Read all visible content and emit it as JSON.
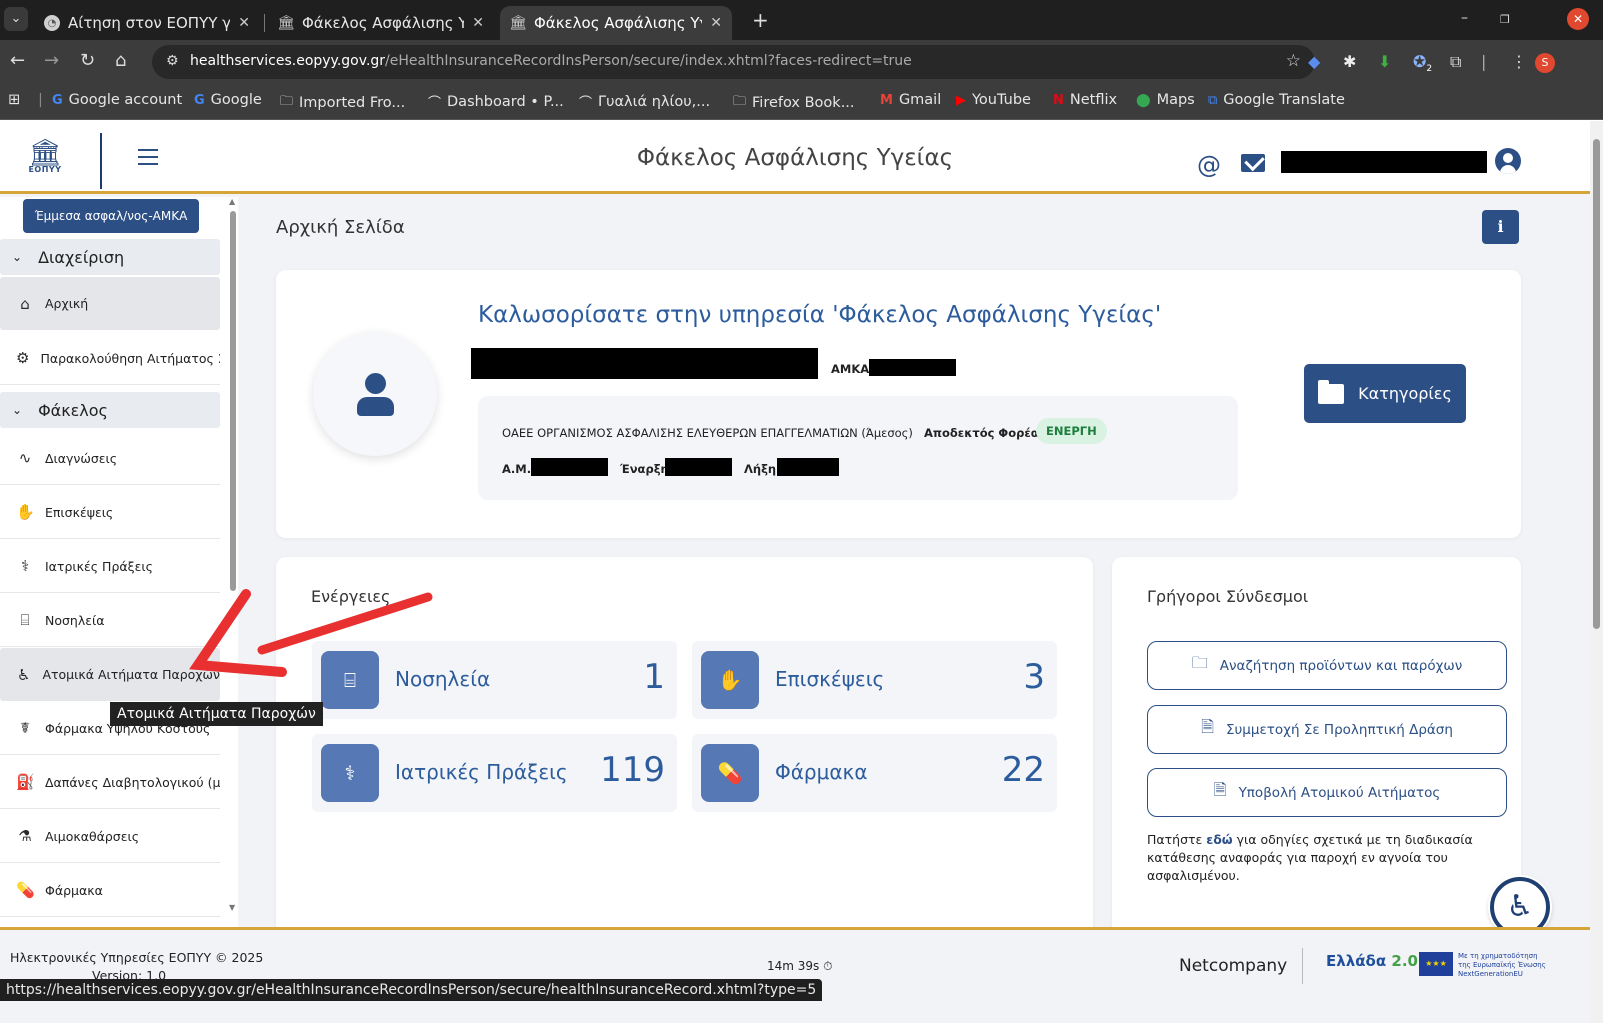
{
  "browser": {
    "tabs": [
      {
        "title": "Αίτηση στον ΕΟΠΥΥ για ν",
        "active": false
      },
      {
        "title": "Φάκελος Ασφάλισης Υγε",
        "active": false
      },
      {
        "title": "Φάκελος Ασφάλισης Υγε",
        "active": true
      }
    ],
    "url_host": "healthservices.eopyy.gov.gr",
    "url_path": "/eHealthInsuranceRecordInsPerson/secure/index.xhtml?faces-redirect=true",
    "profile_initial": "S",
    "extension_badge": "2",
    "bookmarks": [
      {
        "label": "Google account",
        "icon": "google-icon"
      },
      {
        "label": "Google",
        "icon": "google-icon"
      },
      {
        "label": "Imported Fro...",
        "icon": "folder-icon"
      },
      {
        "label": "Dashboard • P...",
        "icon": "sunglasses-icon"
      },
      {
        "label": "Γυαλιά ηλίου,...",
        "icon": "sunglasses-icon"
      },
      {
        "label": "Firefox Book...",
        "icon": "folder-icon"
      },
      {
        "label": "Gmail",
        "icon": "gmail-icon"
      },
      {
        "label": "YouTube",
        "icon": "youtube-icon"
      },
      {
        "label": "Netflix",
        "icon": "netflix-icon"
      },
      {
        "label": "Maps",
        "icon": "maps-icon"
      },
      {
        "label": "Google Translate",
        "icon": "translate-icon"
      }
    ],
    "status_url": "https://healthservices.eopyy.gov.gr/eHealthInsuranceRecordInsPerson/secure/healthInsuranceRecord.xhtml?type=5"
  },
  "header": {
    "logo_text": "ΕΟΠΥΥ",
    "title": "Φάκελος Ασφάλισης Υγείας",
    "at_symbol": "@"
  },
  "sidebar": {
    "indirect_button": "Έμμεσα ασφαλ/νος-ΑΜΚΑ",
    "sections": [
      {
        "label": "Διαχείριση",
        "items": [
          {
            "label": "Αρχική",
            "icon": "home-icon"
          },
          {
            "label": "Παρακολούθηση Αιτήματος Σ.Η.Π",
            "icon": "gear-icon"
          }
        ]
      },
      {
        "label": "Φάκελος",
        "items": [
          {
            "label": "Διαγνώσεις",
            "icon": "heartbeat-icon"
          },
          {
            "label": "Επισκέψεις",
            "icon": "hand-care-icon"
          },
          {
            "label": "Ιατρικές Πράξεις",
            "icon": "doctor-icon"
          },
          {
            "label": "Νοσηλεία",
            "icon": "bed-icon"
          },
          {
            "label": "Ατομικά Αιτήματα Παροχών",
            "icon": "wheelchair-icon"
          },
          {
            "label": "Φάρμακα Υψηλού Κόστους",
            "icon": "pill-hand-icon"
          },
          {
            "label": "Δαπάνες Διαβητολογικού (μέχρι ι",
            "icon": "glucose-icon"
          },
          {
            "label": "Αιμοκαθάρσεις",
            "icon": "dialysis-icon"
          },
          {
            "label": "Φάρμακα",
            "icon": "pills-icon"
          }
        ]
      }
    ],
    "tooltip": "Ατομικά Αιτήματα Παροχών"
  },
  "main": {
    "page_title": "Αρχική Σελίδα",
    "info_label": "i",
    "welcome": {
      "title": "Καλωσορίσατε στην υπηρεσία 'Φάκελος Ασφάλισης Υγείας'",
      "amka_label": "ΑΜΚΑ:",
      "insurer": "ΟΑΕΕ ΟΡΓΑΝΙΣΜΟΣ ΑΣΦΑΛΙΣΗΣ ΕΛΕΥΘΕΡΩΝ ΕΠΑΓΓΕΛΜΑΤΙΩΝ (Άμεσος)",
      "receiver_label": "Αποδεκτός Φορέας:",
      "status": "ΕΝΕΡΓΗ",
      "am_label": "Α.Μ.:",
      "start_label": "Έναρξη:",
      "end_label": "Λήξη:",
      "categories_button": "Κατηγορίες"
    },
    "actions": {
      "title": "Ενέργειες",
      "tiles": [
        {
          "label": "Νοσηλεία",
          "count": "1",
          "icon": "bed-icon"
        },
        {
          "label": "Επισκέψεις",
          "count": "3",
          "icon": "hand-care-icon"
        },
        {
          "label": "Ιατρικές Πράξεις",
          "count": "119",
          "icon": "doctor-icon"
        },
        {
          "label": "Φάρμακα",
          "count": "22",
          "icon": "pills-icon"
        }
      ]
    },
    "quick_links": {
      "title": "Γρήγοροι Σύνδεσμοι",
      "links": [
        {
          "label": "Αναζήτηση προϊόντων και παρόχων",
          "icon": "folder-search-icon"
        },
        {
          "label": "Συμμετοχή Σε Προληπτική Δράση",
          "icon": "document-icon"
        },
        {
          "label": "Υποβολή Ατομικού Αιτήματος",
          "icon": "document-icon"
        }
      ],
      "note_before": "Πατήστε ",
      "note_link": "εδώ",
      "note_after": " για οδηγίες σχετικά με τη διαδικασία κατάθεσης αναφοράς για παροχή εν αγνοία του ασφαλισμένου."
    }
  },
  "footer": {
    "copyright": "Ηλεκτρονικές Υπηρεσίες ΕΟΠΥΥ © 2025",
    "version": "Version: 1.0",
    "timer": "14m 39s",
    "vendor": "Netcompany",
    "greece_logo": "Ελλάδα",
    "greece_version": "2.0",
    "eu_text": "Με τη χρηματοδότηση της Ευρωπαϊκής Ένωσης NextGenerationEU"
  },
  "colors": {
    "primary": "#2c4f85",
    "accent_gold": "#d6a53a",
    "annotation_arrow": "#e83030",
    "status_green": "#1e7e3e"
  }
}
